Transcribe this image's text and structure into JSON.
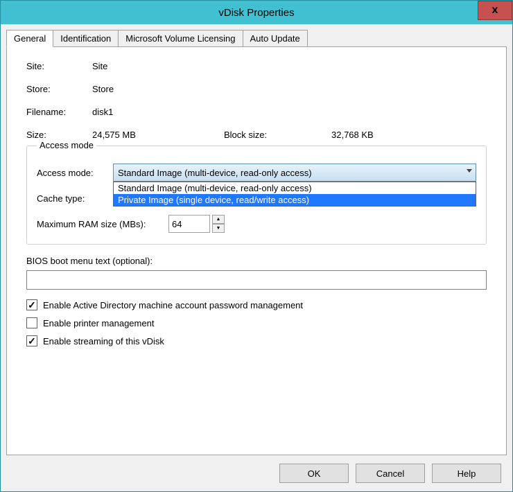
{
  "title": "vDisk Properties",
  "close_label": "x",
  "tabs": {
    "general": "General",
    "identification": "Identification",
    "licensing": "Microsoft Volume Licensing",
    "auto_update": "Auto Update"
  },
  "info": {
    "site_label": "Site:",
    "site_value": "Site",
    "store_label": "Store:",
    "store_value": "Store",
    "filename_label": "Filename:",
    "filename_value": "disk1",
    "size_label": "Size:",
    "size_value": "24,575 MB",
    "block_size_label": "Block size:",
    "block_size_value": "32,768 KB"
  },
  "access_mode": {
    "legend": "Access mode",
    "mode_label": "Access mode:",
    "selected": "Standard Image (multi-device, read-only access)",
    "options": [
      "Standard Image (multi-device, read-only access)",
      "Private Image (single device, read/write access)"
    ],
    "cache_label": "Cache type:",
    "ram_label": "Maximum RAM size (MBs):",
    "ram_value": "64"
  },
  "bios": {
    "label": "BIOS boot menu text (optional):",
    "value": ""
  },
  "checkboxes": {
    "ad_mgmt": "Enable Active Directory machine account password management",
    "printer_mgmt": "Enable printer management",
    "streaming": "Enable streaming of this vDisk"
  },
  "buttons": {
    "ok": "OK",
    "cancel": "Cancel",
    "help": "Help"
  }
}
